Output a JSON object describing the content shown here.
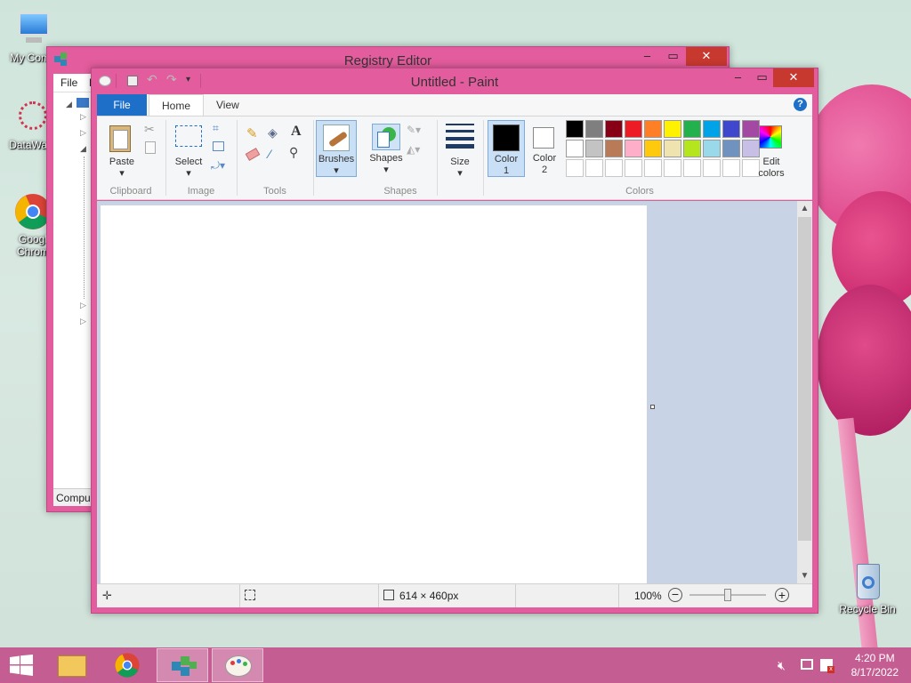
{
  "desktop": {
    "icons": [
      {
        "label": "My Comp",
        "icon": "computer-icon"
      },
      {
        "label": "DataWag",
        "icon": "datawagon-icon"
      },
      {
        "label": "Googl Chrom",
        "icon": "chrome-icon"
      },
      {
        "label": "Recycle Bin",
        "icon": "recycle-bin-icon"
      }
    ]
  },
  "registry_editor": {
    "title": "Registry Editor",
    "menu": [
      "File",
      "E"
    ],
    "status": "Compu"
  },
  "paint": {
    "title": "Untitled - Paint",
    "tabs": {
      "file": "File",
      "home": "Home",
      "view": "View"
    },
    "groups": {
      "clipboard": "Clipboard",
      "image": "Image",
      "tools": "Tools",
      "shapes": "Shapes",
      "colors": "Colors"
    },
    "buttons": {
      "paste": "Paste",
      "select": "Select",
      "brushes": "Brushes",
      "shapes": "Shapes",
      "size": "Size",
      "color1_line1": "Color",
      "color1_line2": "1",
      "color2_line1": "Color",
      "color2_line2": "2",
      "edit_colors_line1": "Edit",
      "edit_colors_line2": "colors"
    },
    "color1": "#000000",
    "color2": "#ffffff",
    "palette_row1": [
      "#000000",
      "#7f7f7f",
      "#880015",
      "#ed1c24",
      "#ff7f27",
      "#fff200",
      "#22b14c",
      "#00a2e8",
      "#3f48cc",
      "#a349a4"
    ],
    "palette_row2": [
      "#ffffff",
      "#c3c3c3",
      "#b97a57",
      "#ffaec9",
      "#ffc90e",
      "#efe4b0",
      "#b5e61d",
      "#99d9ea",
      "#7092be",
      "#c8bfe7"
    ],
    "status": {
      "dimensions": "614 × 460px",
      "zoom": "100%"
    }
  },
  "taskbar": {
    "time": "4:20 PM",
    "date": "8/17/2022"
  }
}
